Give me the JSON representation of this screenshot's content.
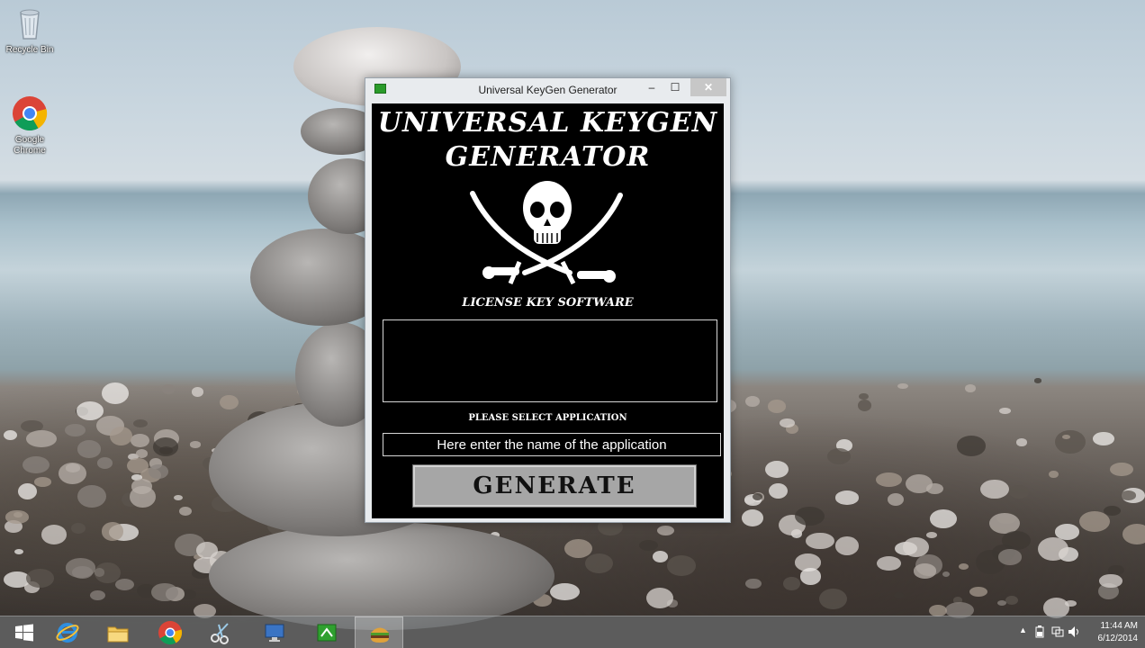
{
  "desktop": {
    "icons": [
      {
        "label": "Recycle Bin",
        "icon": "recycle-bin-icon"
      },
      {
        "label": "Google Chrome",
        "icon": "chrome-icon"
      }
    ]
  },
  "window": {
    "title": "Universal KeyGen Generator",
    "controls": {
      "minimize": "–",
      "maximize": "☐",
      "close": "✕"
    },
    "heading_line1": "UNIVERSAL KEYGEN",
    "heading_line2": "GENERATOR",
    "logo_icon": "skull-crossed-swords-icon",
    "subtitle": "LICENSE KEY SOFTWARE",
    "output_value": "",
    "select_label": "PLEASE SELECT APPLICATION",
    "app_input_placeholder": "Here enter the name of the application",
    "generate_label": "GENERATE"
  },
  "taskbar": {
    "items": [
      {
        "name": "start-button",
        "icon": "windows-logo-icon"
      },
      {
        "name": "internet-explorer",
        "icon": "ie-icon"
      },
      {
        "name": "file-explorer",
        "icon": "folder-icon"
      },
      {
        "name": "google-chrome",
        "icon": "chrome-icon"
      },
      {
        "name": "snipping-tool",
        "icon": "scissors-icon"
      },
      {
        "name": "remote-desktop",
        "icon": "computer-icon"
      },
      {
        "name": "keygen-app",
        "icon": "green-app-icon"
      },
      {
        "name": "burger-app",
        "icon": "burger-icon",
        "active": true
      }
    ],
    "tray": {
      "show_hidden": "▲",
      "time": "11:44 AM",
      "date": "6/12/2014"
    }
  },
  "colors": {
    "window_client": "#000000",
    "button_gray": "#a6a6a6",
    "close_button": "#c7c7c7"
  }
}
